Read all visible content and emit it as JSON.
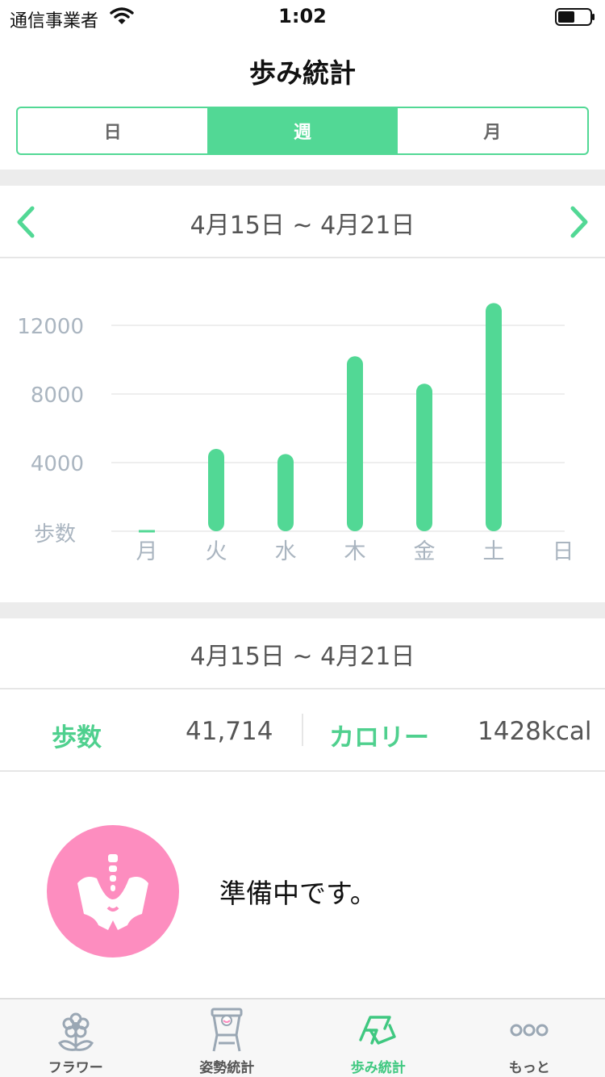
{
  "status_bar": {
    "carrier": "通信事業者",
    "time": "1:02"
  },
  "header": {
    "title": "歩み統計"
  },
  "period_tabs": [
    {
      "label": "日",
      "active": false
    },
    {
      "label": "週",
      "active": true
    },
    {
      "label": "月",
      "active": false
    }
  ],
  "range": {
    "label": "4月15日 ~ 4月21日"
  },
  "chart_data": {
    "type": "bar",
    "categories": [
      "月",
      "火",
      "水",
      "木",
      "金",
      "土",
      "日"
    ],
    "values": [
      0,
      4800,
      4500,
      10200,
      8600,
      13300,
      null
    ],
    "y_ticks": [
      12000,
      8000,
      4000
    ],
    "ylabel": "歩数",
    "ylim": [
      0,
      15000
    ],
    "grid": true,
    "bar_color": "#52d895"
  },
  "summary": {
    "range_label": "4月15日 ~ 4月21日",
    "steps_label": "歩数",
    "steps_value": "41,714",
    "calories_label": "カロリー",
    "calories_value": "1428kcal"
  },
  "notice": {
    "text": "準備中です。"
  },
  "tabbar": [
    {
      "label": "フラワー",
      "icon": "flower-icon",
      "active": false
    },
    {
      "label": "姿勢統計",
      "icon": "posture-chart-icon",
      "active": false
    },
    {
      "label": "歩み統計",
      "icon": "steps-chart-icon",
      "active": true
    },
    {
      "label": "もっと",
      "icon": "more-icon",
      "active": false
    }
  ],
  "colors": {
    "accent": "#52d895",
    "accent_text": "#4fd08e",
    "notice_circle": "#fd8dbf",
    "inactive_icon": "#9aa7b4"
  }
}
